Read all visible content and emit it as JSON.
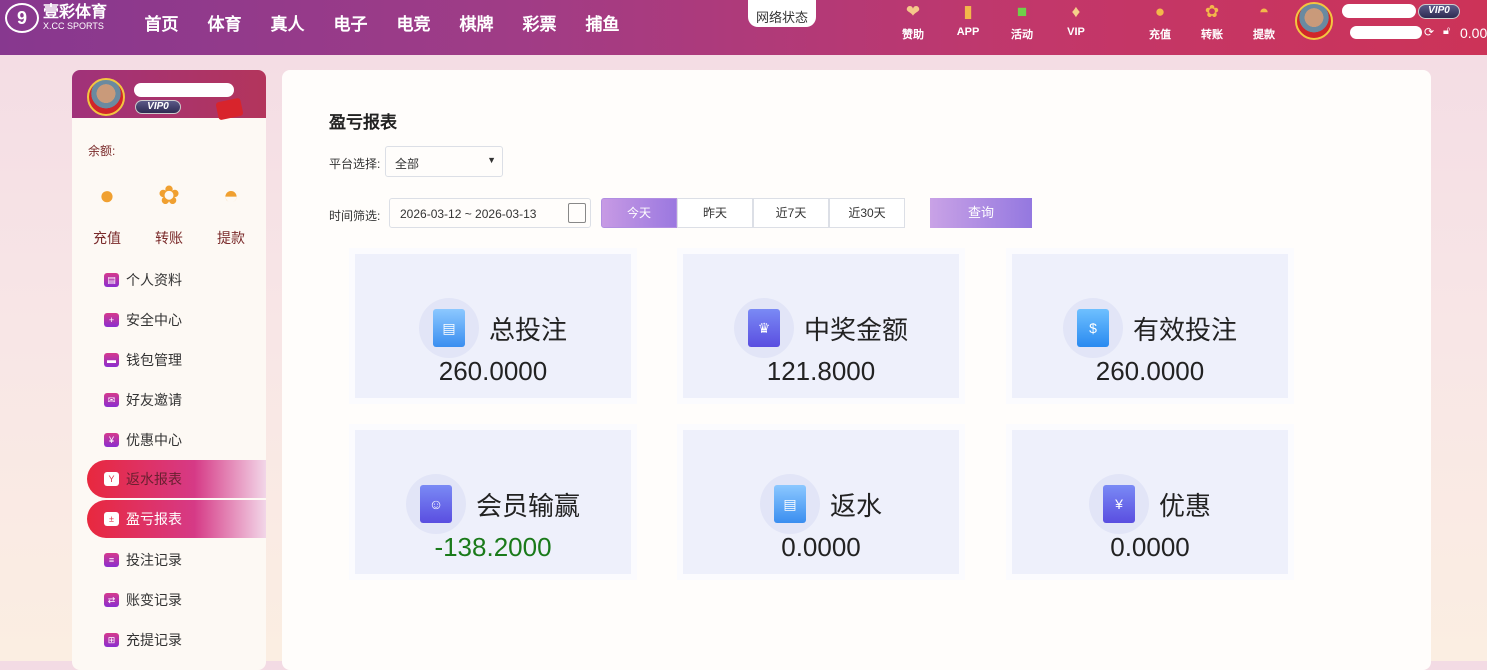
{
  "header": {
    "logo_cn": "壹彩体育",
    "logo_en": "X.CC SPORTS",
    "nav": [
      "首页",
      "体育",
      "真人",
      "电子",
      "电竞",
      "棋牌",
      "彩票",
      "捕鱼"
    ],
    "network_status": "网络状态",
    "links": [
      {
        "label": "赞助",
        "icon": "handshake-icon"
      },
      {
        "label": "APP",
        "icon": "phone-icon"
      },
      {
        "label": "活动",
        "icon": "gift-icon"
      },
      {
        "label": "VIP",
        "icon": "diamond-icon"
      }
    ],
    "wallet_links": [
      {
        "label": "充值",
        "icon": "money-bag-icon"
      },
      {
        "label": "转账",
        "icon": "goldfish-icon"
      },
      {
        "label": "提款",
        "icon": "fan-icon"
      }
    ],
    "vip": "VIP0",
    "balance": "0.00"
  },
  "sidebar": {
    "vip": "VIP0",
    "balance_label": "余额:",
    "quick": [
      {
        "label": "充值",
        "icon": "money-bag-icon"
      },
      {
        "label": "转账",
        "icon": "goldfish-icon"
      },
      {
        "label": "提款",
        "icon": "fan-icon"
      }
    ],
    "menu": [
      {
        "label": "个人资料"
      },
      {
        "label": "安全中心"
      },
      {
        "label": "钱包管理"
      },
      {
        "label": "好友邀请"
      },
      {
        "label": "优惠中心"
      },
      {
        "label": "返水报表"
      },
      {
        "label": "盈亏报表"
      },
      {
        "label": "投注记录"
      },
      {
        "label": "账变记录"
      },
      {
        "label": "充提记录"
      }
    ]
  },
  "main": {
    "title": "盈亏报表",
    "platform_label": "平台选择:",
    "platform_value": "全部",
    "time_label": "时间筛选:",
    "date_range": "2026-03-12 ~ 2026-03-13",
    "tabs": [
      "今天",
      "昨天",
      "近7天",
      "近30天"
    ],
    "active_tab": "今天",
    "query": "查询",
    "stats": [
      {
        "label": "总投注",
        "value": "260.0000"
      },
      {
        "label": "中奖金额",
        "value": "121.8000"
      },
      {
        "label": "有效投注",
        "value": "260.0000"
      },
      {
        "label": "会员输赢",
        "value": "-138.2000"
      },
      {
        "label": "返水",
        "value": "0.0000"
      },
      {
        "label": "优惠",
        "value": "0.0000"
      }
    ]
  }
}
